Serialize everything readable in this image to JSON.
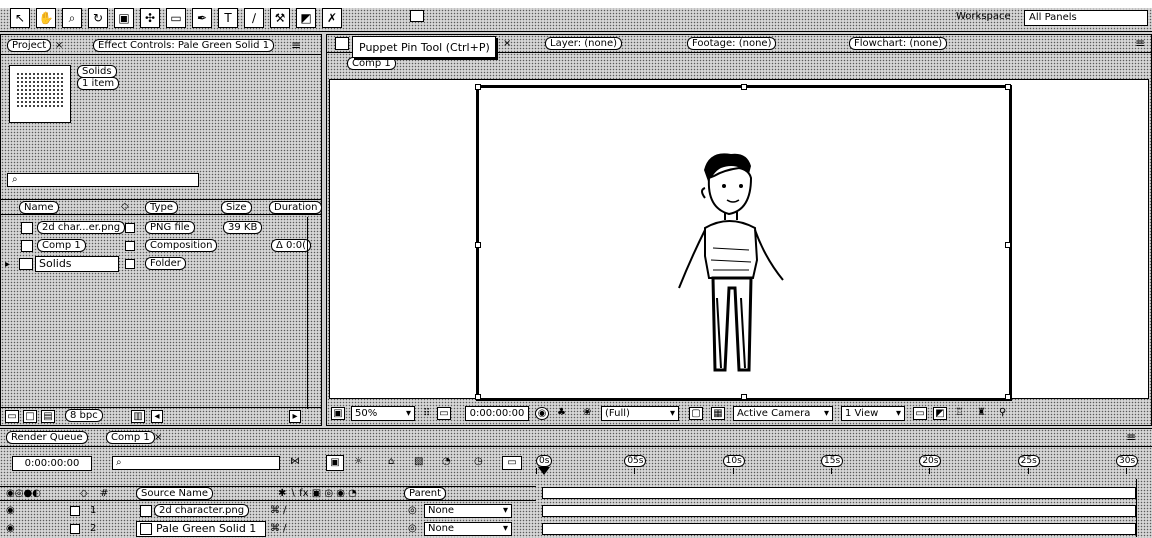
{
  "toolbar": {
    "tools": [
      "selection-tool-icon",
      "hand-tool-icon",
      "zoom-tool-icon",
      "rotate-tool-icon",
      "camera-tool-icon",
      "pan-behind-tool-icon",
      "rectangle-tool-icon",
      "pen-tool-icon",
      "text-tool-icon",
      "brush-tool-icon",
      "clone-stamp-tool-icon",
      "eraser-tool-icon",
      "puppet-pin-tool-icon"
    ],
    "workspace_label": "Workspace",
    "workspace_value": "All Panels"
  },
  "tooltip": "Puppet Pin Tool (Ctrl+P)",
  "project_panel": {
    "tab_project": "Project",
    "tab_effect_controls": "Effect Controls: Pale Green Solid 1",
    "thumb_title": "Solids",
    "thumb_sub": "1 item",
    "columns": [
      "Name",
      "Type",
      "Size",
      "Duration"
    ],
    "items": [
      {
        "name": "2d char...er.png",
        "type": "PNG file",
        "size": "39 KB",
        "duration": ""
      },
      {
        "name": "Comp 1",
        "type": "Composition",
        "size": "",
        "duration": "Δ 0:0("
      },
      {
        "name": "Solids",
        "type": "Folder",
        "size": "",
        "duration": ""
      }
    ],
    "bpc": "8 bpc"
  },
  "viewer": {
    "tab_comp": "Composition: Comp 1",
    "tab_layer": "Layer: (none)",
    "tab_footage": "Footage: (none)",
    "tab_flowchart": "Flowchart: (none)",
    "comp_button": "Comp 1",
    "zoom": "50%",
    "timecode": "0:00:00:00",
    "resolution": "(Full)",
    "camera": "Active Camera",
    "views": "1 View"
  },
  "timeline": {
    "tab_render_queue": "Render Queue",
    "tab_comp": "Comp 1",
    "timecode": "0:00:00:00",
    "column_source_name": "Source Name",
    "column_parent": "Parent",
    "ruler_ticks": [
      "0s",
      "05s",
      "10s",
      "15s",
      "20s",
      "25s",
      "30s"
    ],
    "layers": [
      {
        "number": "1",
        "name": "2d character.png",
        "parent": "None"
      },
      {
        "number": "2",
        "name": "Pale Green Solid 1",
        "parent": "None"
      }
    ]
  }
}
